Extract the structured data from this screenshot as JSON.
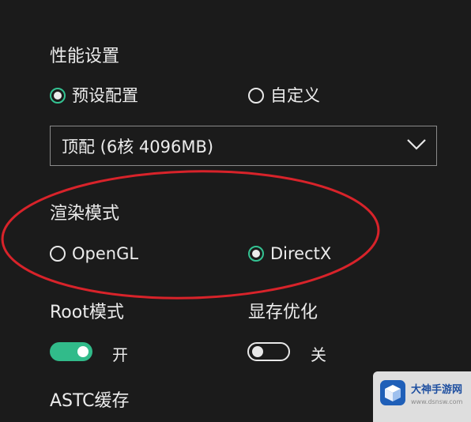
{
  "performance": {
    "title": "性能设置",
    "options": [
      {
        "label": "预设配置",
        "checked": true
      },
      {
        "label": "自定义",
        "checked": false
      }
    ],
    "preset_value": "顶配 (6核 4096MB)"
  },
  "render": {
    "title": "渲染模式",
    "options": [
      {
        "label": "OpenGL",
        "checked": false
      },
      {
        "label": "DirectX",
        "checked": true
      }
    ]
  },
  "root_mode": {
    "title": "Root模式",
    "state_label": "开",
    "enabled": true
  },
  "vram_opt": {
    "title": "显存优化",
    "state_label": "关",
    "enabled": false
  },
  "astc": {
    "title": "ASTC缓存"
  },
  "watermark": {
    "title": "大神手游网",
    "url": "www.dsnsw.com"
  },
  "colors": {
    "background": "#1b1b1b",
    "accent": "#31bb8a",
    "annotation": "#d8232a",
    "text": "#ececec"
  },
  "icons": {
    "dropdown": "chevron-down-icon",
    "watermark_logo": "cube-logo-icon"
  }
}
